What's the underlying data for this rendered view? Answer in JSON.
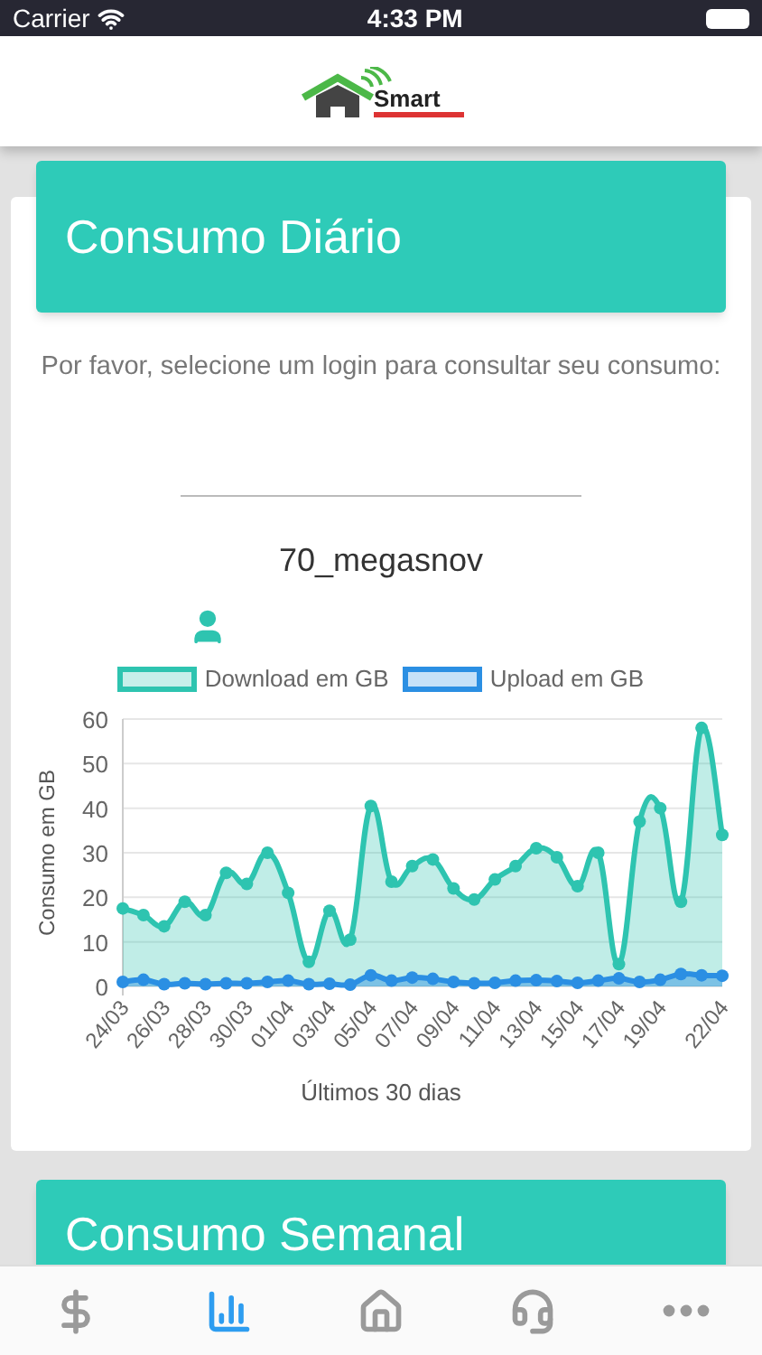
{
  "status_bar": {
    "carrier": "Carrier",
    "time": "4:33 PM"
  },
  "header": {
    "logo_text": "Smart"
  },
  "cards": [
    {
      "title": "Consumo Diário",
      "prompt": "Por favor, selecione um login para consultar seu consumo:",
      "login": "70_megasnov",
      "chart_data": {
        "type": "area",
        "xlabel": "Últimos 30 dias",
        "ylabel": "Consumo em GB",
        "categories": [
          "24/03",
          null,
          "26/03",
          null,
          "28/03",
          null,
          "30/03",
          null,
          "01/04",
          null,
          "03/04",
          null,
          "05/04",
          null,
          "07/04",
          null,
          "09/04",
          null,
          "11/04",
          null,
          "13/04",
          null,
          "15/04",
          null,
          "17/04",
          null,
          "19/04",
          null,
          null,
          "22/04"
        ],
        "grid": true,
        "legend": true,
        "ylim": [
          0,
          60
        ],
        "yticks": [
          0,
          10,
          20,
          30,
          40,
          50,
          60
        ],
        "series": [
          {
            "name": "Download em GB",
            "color": "#2ec4b0",
            "values": [
              17.5,
              16,
              13.5,
              19,
              16,
              25.5,
              23,
              30,
              21,
              5.5,
              17,
              10.5,
              40.5,
              23.5,
              27,
              28.5,
              22,
              19.5,
              24,
              27,
              31,
              29,
              22.5,
              30,
              5,
              37,
              40,
              19,
              58,
              34
            ]
          },
          {
            "name": "Upload em GB",
            "color": "#2b8fe3",
            "values": [
              1,
              1.5,
              0.5,
              0.7,
              0.5,
              0.7,
              0.7,
              1,
              1.3,
              0.5,
              0.6,
              0.4,
              2.5,
              1.3,
              2,
              1.7,
              1,
              0.7,
              0.8,
              1.3,
              1.4,
              1.2,
              0.8,
              1.3,
              1.8,
              1,
              1.5,
              2.8,
              2.5,
              2.4
            ]
          }
        ]
      }
    },
    {
      "title": "Consumo Semanal"
    }
  ],
  "tabs": [
    {
      "kind": "dollar",
      "selected": false
    },
    {
      "kind": "chart",
      "selected": true
    },
    {
      "kind": "home",
      "selected": false
    },
    {
      "kind": "support",
      "selected": false
    },
    {
      "kind": "more",
      "selected": false
    }
  ]
}
